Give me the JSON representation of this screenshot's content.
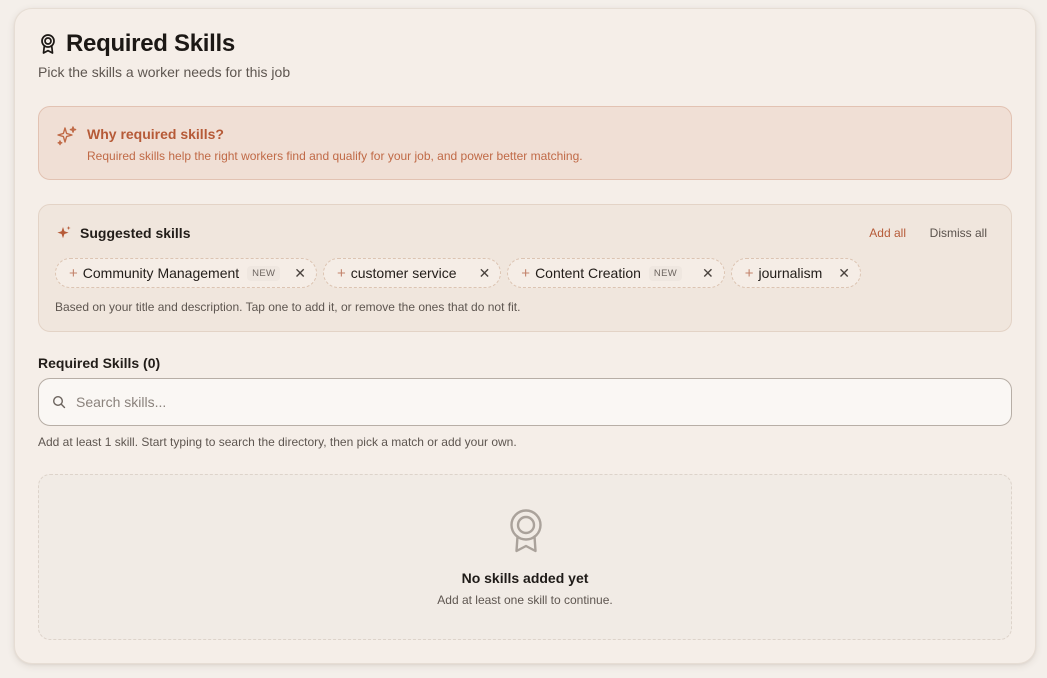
{
  "header": {
    "title": "Required Skills",
    "subtitle": "Pick the skills a worker needs for this job",
    "icon": "award-icon"
  },
  "why": {
    "icon": "sparkles-icon",
    "title": "Why required skills?",
    "description": "Required skills help the right workers find and qualify for your job, and power better matching."
  },
  "suggested": {
    "icon": "sparkle-icon",
    "title": "Suggested skills",
    "add_all": "Add all",
    "dismiss_all": "Dismiss all",
    "chips": [
      {
        "label": "Community Management",
        "badge": "NEW"
      },
      {
        "label": "customer service",
        "badge": ""
      },
      {
        "label": "Content Creation",
        "badge": "NEW"
      },
      {
        "label": "journalism",
        "badge": ""
      }
    ],
    "hint": "Based on your title and description. Tap one to add it, or remove the ones that do not fit."
  },
  "required": {
    "label": "Required Skills (0)",
    "search_placeholder": "Search skills...",
    "search_value": "",
    "hint": "Add at least 1 skill. Start typing to search the directory, then pick a match or add your own."
  },
  "empty_state": {
    "icon": "award-icon",
    "title": "No skills added yet",
    "description": "Add at least one skill to continue."
  },
  "colors": {
    "accent": "#b65a37",
    "background": "#f5eee8",
    "why_bg": "#f0dfd5",
    "suggested_bg": "#f0e6dd"
  }
}
